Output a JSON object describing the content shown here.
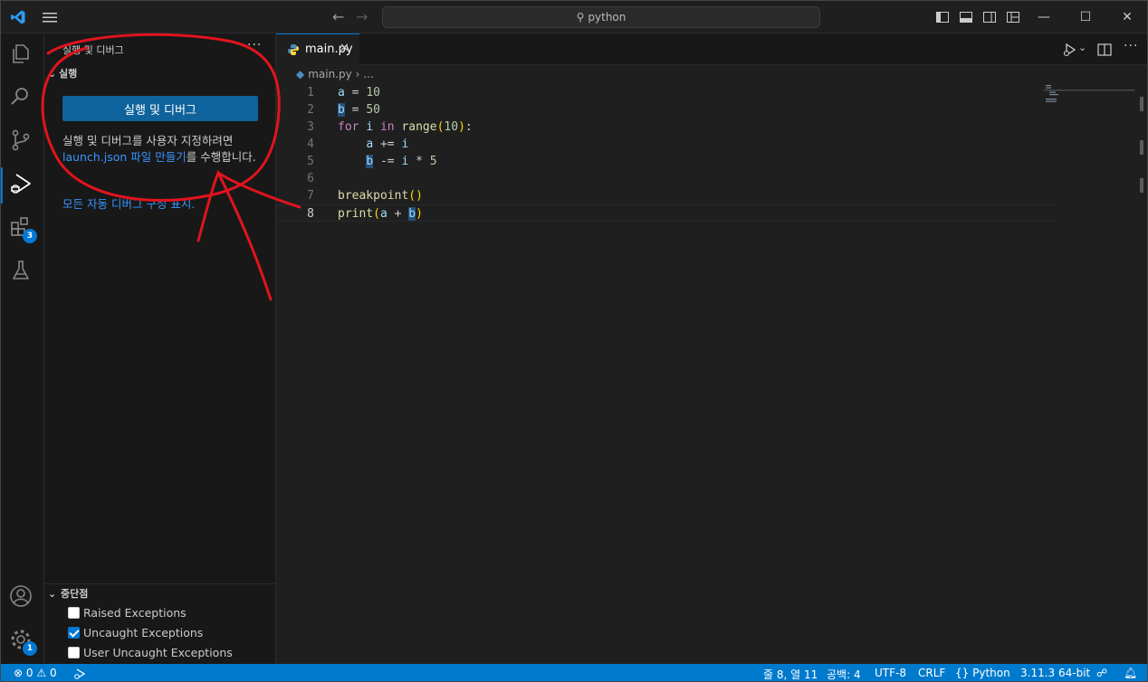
{
  "titlebar": {
    "search_text": "python"
  },
  "activitybar": {
    "extensions_badge": "3",
    "manage_badge": "1"
  },
  "sidebar": {
    "title": "실행 및 디버그",
    "more": "···",
    "section_label": "실행",
    "run_button": "실행 및 디버그",
    "text_before_link": "실행 및 디버그를 사용자 지정하려면 ",
    "link_launch": "launch.json 파일 만들기",
    "text_after_link": "를 수행합니다.",
    "link_show_all": "모든 자동 디버그 구성 표시.",
    "breakpoints_header": "중단점",
    "breakpoints": [
      {
        "label": "Raised Exceptions",
        "checked": false
      },
      {
        "label": "Uncaught Exceptions",
        "checked": true
      },
      {
        "label": "User Uncaught Exceptions",
        "checked": false
      }
    ]
  },
  "editor": {
    "tab_label": "main.py",
    "breadcrumb_file": "main.py",
    "breadcrumb_sep": "›",
    "breadcrumb_more": "...",
    "line_numbers": [
      "1",
      "2",
      "3",
      "4",
      "5",
      "6",
      "7",
      "8"
    ],
    "code_lines": [
      "a = 10",
      "b = 50",
      "for i in range(10):",
      "    a += i",
      "    b -= i * 5",
      "",
      "breakpoint()",
      "print(a + b)"
    ]
  },
  "statusbar": {
    "errors": "0",
    "warnings": "0",
    "position": "줄 8, 열 11",
    "spaces": "공백: 4",
    "encoding": "UTF-8",
    "eol": "CRLF",
    "language": "Python",
    "interpreter": "3.11.3 64-bit"
  },
  "colors": {
    "accent": "#0078d4",
    "statusbar": "#007acc",
    "run_button": "#0e639c",
    "link": "#3794ff",
    "annotation": "#e0141e"
  }
}
